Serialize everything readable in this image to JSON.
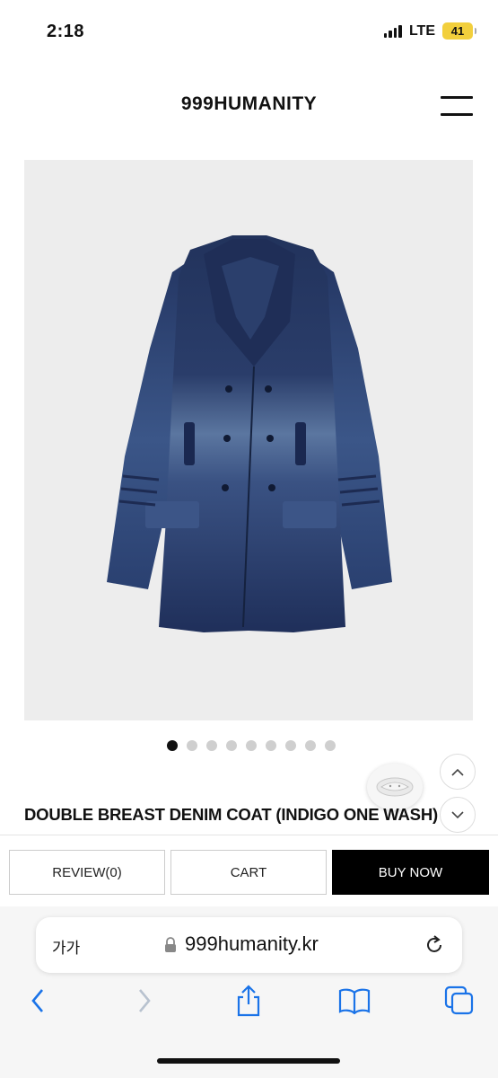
{
  "status_bar": {
    "time": "2:18",
    "network": "LTE",
    "battery": "41"
  },
  "header": {
    "brand": "999HUMANITY"
  },
  "gallery": {
    "total": 9,
    "active_index": 0
  },
  "product": {
    "title": "DOUBLE BREAST DENIM COAT (INDIGO ONE WASH)"
  },
  "actions": {
    "review": "REVIEW(0)",
    "cart": "CART",
    "buy": "BUY NOW"
  },
  "browser": {
    "text_size": "가가",
    "url": "999humanity.kr"
  },
  "colors": {
    "accent": "#000000",
    "inactive_dot": "#cfcfcf",
    "battery": "#f2cf3c",
    "safari_blue": "#1a73e8"
  }
}
